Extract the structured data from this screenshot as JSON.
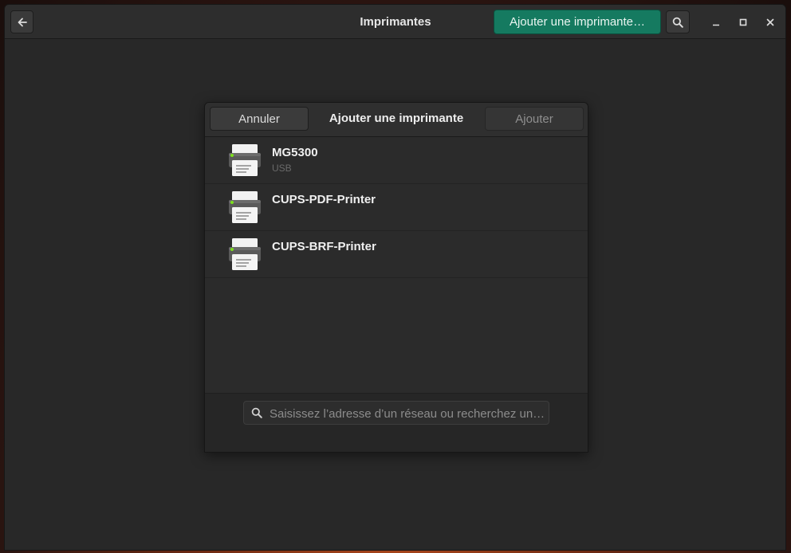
{
  "window": {
    "title": "Imprimantes",
    "add_printer_label": "Ajouter une imprimante…",
    "accent_color": "#157a60"
  },
  "icons": {
    "back": "arrow-left-icon",
    "search": "search-icon",
    "minimize": "minimize-icon",
    "maximize": "maximize-icon",
    "close": "close-icon",
    "printer": "printer-icon"
  },
  "dialog": {
    "title": "Ajouter une imprimante",
    "cancel_label": "Annuler",
    "confirm_label": "Ajouter",
    "printers": [
      {
        "name": "MG5300",
        "connection": "USB"
      },
      {
        "name": "CUPS-PDF-Printer",
        "connection": ""
      },
      {
        "name": "CUPS-BRF-Printer",
        "connection": ""
      }
    ],
    "search": {
      "placeholder": "Saisissez l’adresse d’un réseau ou recherchez un…",
      "value": ""
    }
  }
}
